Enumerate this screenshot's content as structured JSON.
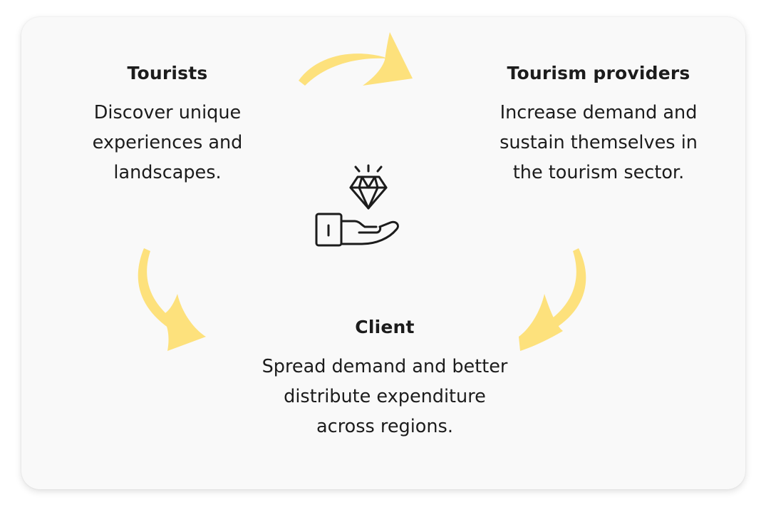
{
  "tourists": {
    "title": "Tourists",
    "description": "Discover unique experiences and landscapes."
  },
  "providers": {
    "title": "Tourism providers",
    "description": "Increase demand and sustain themselves in the tourism sector."
  },
  "client": {
    "title": "Client",
    "description": "Spread demand and better distribute expenditure across regions."
  },
  "center_icon": "diamond-in-hand-icon",
  "arrow_color": "#fde17c",
  "icon_color": "#1c1c1c",
  "card_color": "#f9f9f9"
}
